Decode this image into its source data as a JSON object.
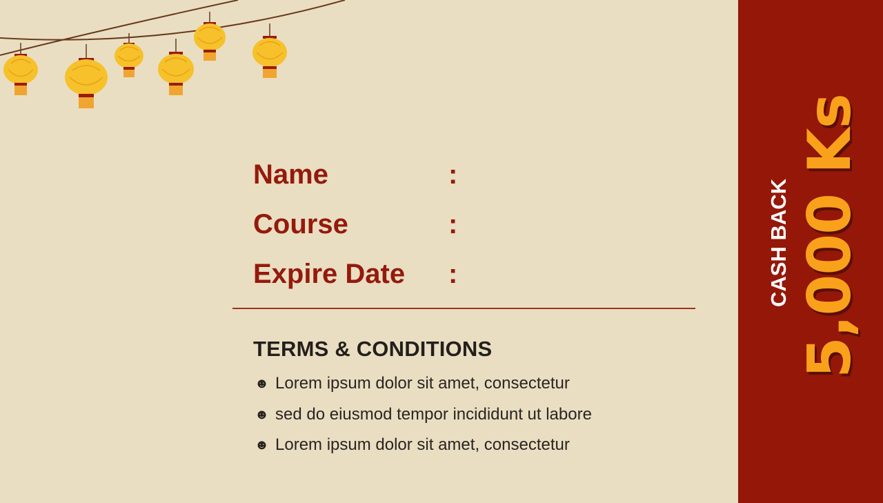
{
  "form": {
    "fields": [
      {
        "label": "Name",
        "colon": ":"
      },
      {
        "label": "Course",
        "colon": ":"
      },
      {
        "label": "Expire Date",
        "colon": ":"
      }
    ]
  },
  "terms": {
    "title": "TERMS & CONDITIONS",
    "bullet": "☻",
    "items": [
      "Lorem ipsum dolor sit amet, consectetur",
      "sed do eiusmod tempor incididunt ut labore",
      "Lorem ipsum dolor sit amet, consectetur"
    ]
  },
  "side_panel": {
    "label": "CASH BACK",
    "amount": "5,000 Ks"
  },
  "colors": {
    "background": "#E9DEC2",
    "accent_red": "#941707",
    "gold": "#F9A11B",
    "lantern_fill": "#F6C12A"
  },
  "decorations": {
    "lantern_count": 6
  }
}
